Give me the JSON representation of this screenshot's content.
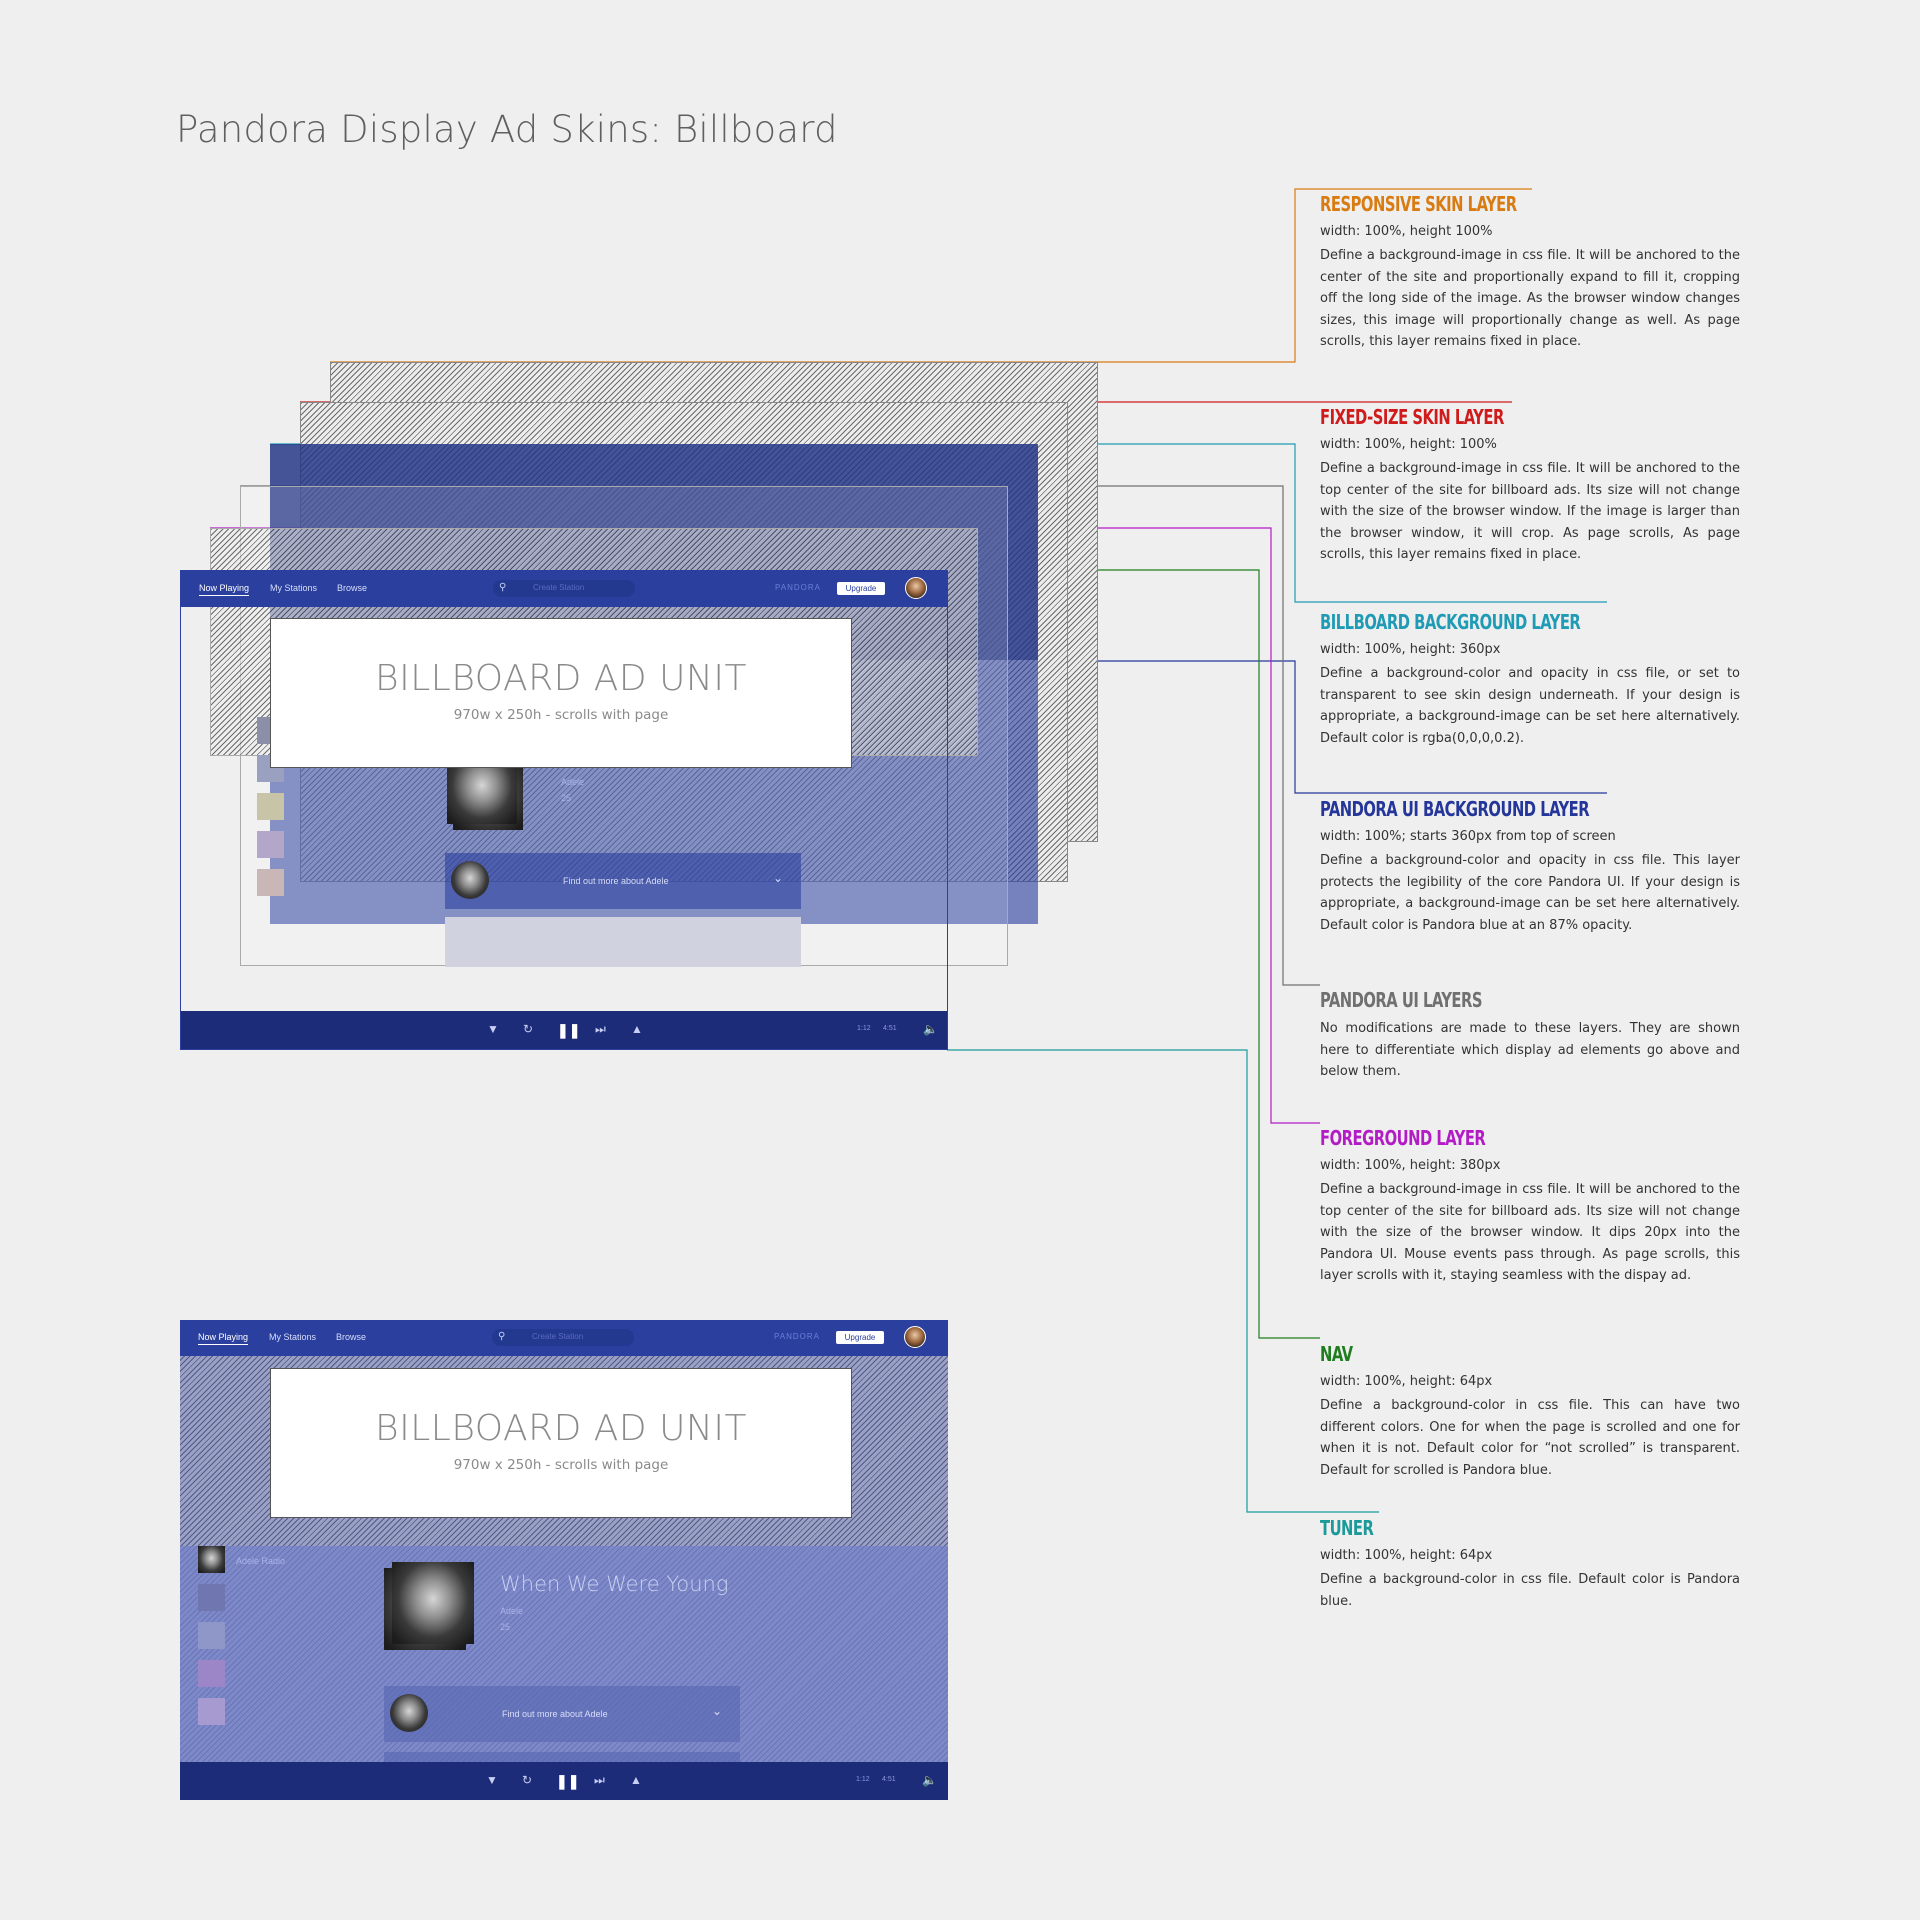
{
  "page_title": "Pandora Display Ad Skins: Billboard",
  "colors": {
    "responsive": "#d97b13",
    "fixed_size": "#cf1b1b",
    "billboard_bg": "#1f9bb5",
    "pandora_ui_bg": "#25369a",
    "pandora_ui": "#707070",
    "foreground": "#b31bc6",
    "nav": "#1f7d1f",
    "tuner": "#1b9a9a",
    "pandora_blue": "#2a3f9e"
  },
  "mock": {
    "nav_items": [
      "Now Playing",
      "My Stations",
      "Browse"
    ],
    "search_placeholder": "Create Station",
    "brand": "PANDORA",
    "upgrade": "Upgrade",
    "ad_title": "BILLBOARD AD UNIT",
    "ad_subtitle": "970w x 250h - scrolls with page",
    "station": "Adele Radio",
    "song": "When We Were Young",
    "artist": "Adele",
    "album": "25",
    "find_out": "Find out more about Adele",
    "time_elapsed": "1:12",
    "time_total": "4:51"
  },
  "annotations": [
    {
      "key": "responsive",
      "title": "RESPONSIVE  SKIN LAYER",
      "dims": "width: 100%, height 100%",
      "desc": "Define a background-image in css file. It will be anchored to the center of the site and proportionally expand to fill it, cropping off the long side of the image. As the browser window changes sizes, this image will proportionally change as well. As page scrolls, this layer remains fixed in place."
    },
    {
      "key": "fixed_size",
      "title": "FIXED-SIZE SKIN LAYER",
      "dims": "width: 100%, height: 100%",
      "desc": "Define a background-image in css file. It will be anchored to the top center of the site for billboard ads. Its size will not change with the size of the browser window. If the image is larger than the browser window, it will crop.  As page scrolls,  As page scrolls, this layer remains fixed in place."
    },
    {
      "key": "billboard_bg",
      "title": "BILLBOARD BACKGROUND LAYER",
      "dims": "width: 100%, height: 360px",
      "desc": "Define a background-color and opacity in css file, or set to transparent to see skin design underneath. If your design is appropriate, a background-image can be set here alternatively. Default color is rgba(0,0,0,0.2)."
    },
    {
      "key": "pandora_ui_bg",
      "title": "PANDORA UI BACKGROUND LAYER",
      "dims": "width: 100%; starts 360px from top of screen",
      "desc": "Define a background-color and opacity in css file. This layer protects the legibility of the core Pandora UI. If your design is appropriate, a background-image can be set here alternatively. Default color is Pandora blue at an 87% opacity."
    },
    {
      "key": "pandora_ui",
      "title": "PANDORA UI LAYERS",
      "dims": "",
      "desc": "No modifications are made to these layers. They are shown here to differentiate which display ad elements go above and below them."
    },
    {
      "key": "foreground",
      "title": "FOREGROUND LAYER",
      "dims": "width: 100%, height: 380px",
      "desc": "Define a background-image in css file. It will be anchored to the top center of the site for billboard ads. Its size will not change with the size of the browser window. It dips 20px into the Pandora UI. Mouse events pass through. As page scrolls, this layer scrolls with it, staying seamless with the dispay ad."
    },
    {
      "key": "nav",
      "title": "NAV",
      "dims": "width: 100%, height: 64px",
      "desc": "Define a background-color in css file. This can have two different colors. One for when the page is scrolled and one for when it is not. Default color for “not scrolled” is transparent. Default for scrolled is Pandora blue."
    },
    {
      "key": "tuner",
      "title": "TUNER",
      "dims": "width: 100%, height: 64px",
      "desc": "Define a background-color in css file. Default color is Pandora blue."
    }
  ]
}
